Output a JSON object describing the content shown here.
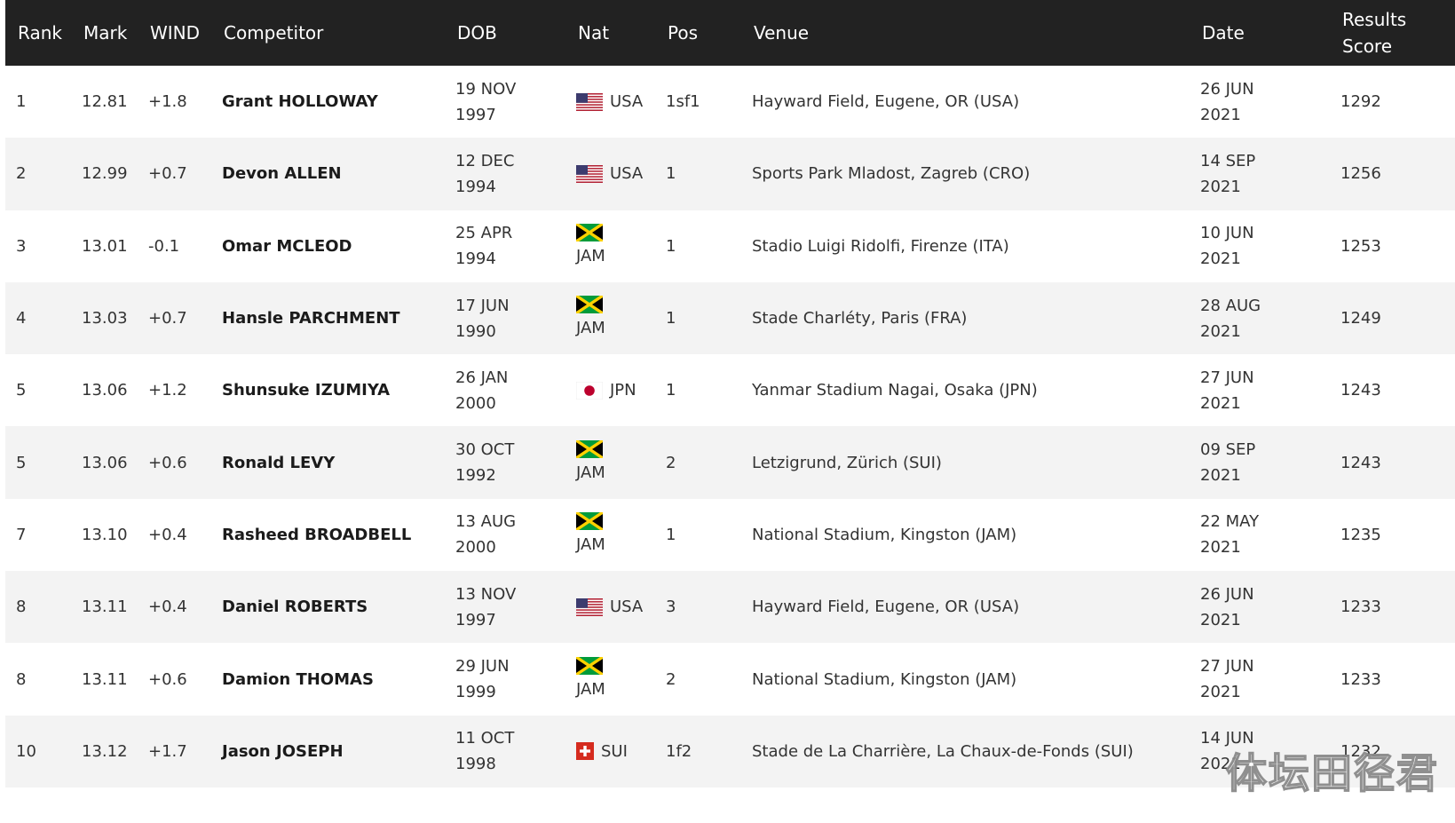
{
  "headers": {
    "rank": "Rank",
    "mark": "Mark",
    "wind": "WIND",
    "competitor": "Competitor",
    "dob": "DOB",
    "nat": "Nat",
    "pos": "Pos",
    "venue": "Venue",
    "date": "Date",
    "score_line1": "Results",
    "score_line2": "Score"
  },
  "rows": [
    {
      "rank": "1",
      "mark": "12.81",
      "wind": "+1.8",
      "competitor": "Grant HOLLOWAY",
      "dob_line1": "19 NOV",
      "dob_line2": "1997",
      "nat": "USA",
      "flag": "usa-flag-icon",
      "pos": "1sf1",
      "venue": "Hayward Field, Eugene, OR (USA)",
      "date_line1": "26 JUN",
      "date_line2": "2021",
      "score": "1292"
    },
    {
      "rank": "2",
      "mark": "12.99",
      "wind": "+0.7",
      "competitor": "Devon ALLEN",
      "dob_line1": "12 DEC",
      "dob_line2": "1994",
      "nat": "USA",
      "flag": "usa-flag-icon",
      "pos": "1",
      "venue": "Sports Park Mladost, Zagreb (CRO)",
      "date_line1": "14 SEP",
      "date_line2": "2021",
      "score": "1256"
    },
    {
      "rank": "3",
      "mark": "13.01",
      "wind": "-0.1",
      "competitor": "Omar MCLEOD",
      "dob_line1": "25 APR",
      "dob_line2": "1994",
      "nat": "JAM",
      "flag": "jamaica-flag-icon",
      "pos": "1",
      "venue": "Stadio Luigi Ridolfi, Firenze (ITA)",
      "date_line1": "10 JUN",
      "date_line2": "2021",
      "score": "1253"
    },
    {
      "rank": "4",
      "mark": "13.03",
      "wind": "+0.7",
      "competitor": "Hansle PARCHMENT",
      "dob_line1": "17 JUN",
      "dob_line2": "1990",
      "nat": "JAM",
      "flag": "jamaica-flag-icon",
      "pos": "1",
      "venue": "Stade Charléty, Paris (FRA)",
      "date_line1": "28 AUG",
      "date_line2": "2021",
      "score": "1249"
    },
    {
      "rank": "5",
      "mark": "13.06",
      "wind": "+1.2",
      "competitor": "Shunsuke IZUMIYA",
      "dob_line1": "26 JAN",
      "dob_line2": "2000",
      "nat": "JPN",
      "flag": "japan-flag-icon",
      "pos": "1",
      "venue": "Yanmar Stadium Nagai, Osaka (JPN)",
      "date_line1": "27 JUN",
      "date_line2": "2021",
      "score": "1243"
    },
    {
      "rank": "5",
      "mark": "13.06",
      "wind": "+0.6",
      "competitor": "Ronald LEVY",
      "dob_line1": "30 OCT",
      "dob_line2": "1992",
      "nat": "JAM",
      "flag": "jamaica-flag-icon",
      "pos": "2",
      "venue": "Letzigrund, Zürich (SUI)",
      "date_line1": "09 SEP",
      "date_line2": "2021",
      "score": "1243"
    },
    {
      "rank": "7",
      "mark": "13.10",
      "wind": "+0.4",
      "competitor": "Rasheed BROADBELL",
      "dob_line1": "13 AUG",
      "dob_line2": "2000",
      "nat": "JAM",
      "flag": "jamaica-flag-icon",
      "pos": "1",
      "venue": "National Stadium, Kingston (JAM)",
      "date_line1": "22 MAY",
      "date_line2": "2021",
      "score": "1235"
    },
    {
      "rank": "8",
      "mark": "13.11",
      "wind": "+0.4",
      "competitor": "Daniel ROBERTS",
      "dob_line1": "13 NOV",
      "dob_line2": "1997",
      "nat": "USA",
      "flag": "usa-flag-icon",
      "pos": "3",
      "venue": "Hayward Field, Eugene, OR (USA)",
      "date_line1": "26 JUN",
      "date_line2": "2021",
      "score": "1233"
    },
    {
      "rank": "8",
      "mark": "13.11",
      "wind": "+0.6",
      "competitor": "Damion THOMAS",
      "dob_line1": "29 JUN",
      "dob_line2": "1999",
      "nat": "JAM",
      "flag": "jamaica-flag-icon",
      "pos": "2",
      "venue": "National Stadium, Kingston (JAM)",
      "date_line1": "27 JUN",
      "date_line2": "2021",
      "score": "1233"
    },
    {
      "rank": "10",
      "mark": "13.12",
      "wind": "+1.7",
      "competitor": "Jason JOSEPH",
      "dob_line1": "11 OCT",
      "dob_line2": "1998",
      "nat": "SUI",
      "flag": "switzerland-flag-icon",
      "pos": "1f2",
      "venue": "Stade de La Charrière, La Chaux-de-Fonds (SUI)",
      "date_line1": "14 JUN",
      "date_line2": "2021",
      "score": "1232"
    }
  ],
  "watermark": "体坛田径君",
  "colors": {
    "header_bg": "#222222",
    "row_alt_bg": "#f3f3f3"
  }
}
